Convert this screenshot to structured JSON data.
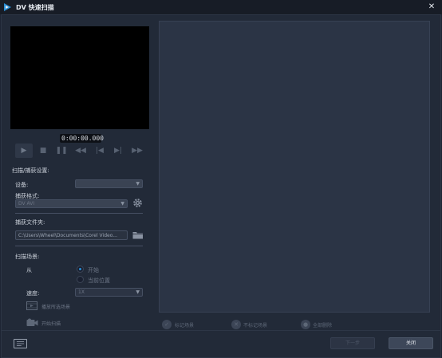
{
  "window": {
    "title": "DV 快速扫描",
    "close_glyph": "✕"
  },
  "preview": {
    "timecode": "0:00:00.000"
  },
  "transport": {
    "buttons": [
      "play-icon",
      "stop-icon",
      "pause-icon",
      "rewind-icon",
      "previous-icon",
      "next-icon",
      "fast-forward-icon"
    ]
  },
  "settings": {
    "section_title": "扫描/捕获设置:",
    "device_label": "设备:",
    "device_value": "",
    "format_label": "捕获格式:",
    "format_value": "DV AVI",
    "folder_label": "捕获文件夹:",
    "folder_value": "C:\\Users\\Wheel\\Documents\\Corel Video...",
    "scan_scene_title": "扫描场景:",
    "from_label": "从",
    "option_start": "开始",
    "option_current": "当前位置",
    "speed_label": "速度:",
    "speed_value": "1X",
    "play_selected_label": "播放所选场景",
    "start_scan_label": "开始扫描"
  },
  "actions": {
    "mark_scene": "标记场景",
    "unmark_scene": "不标记场景",
    "delete_all": "全部删除"
  },
  "footer": {
    "next_label": "下一步",
    "close_label": "关闭"
  },
  "colors": {
    "background": "#222a38",
    "panel": "#2b3445",
    "accent": "#2a8fd6"
  }
}
